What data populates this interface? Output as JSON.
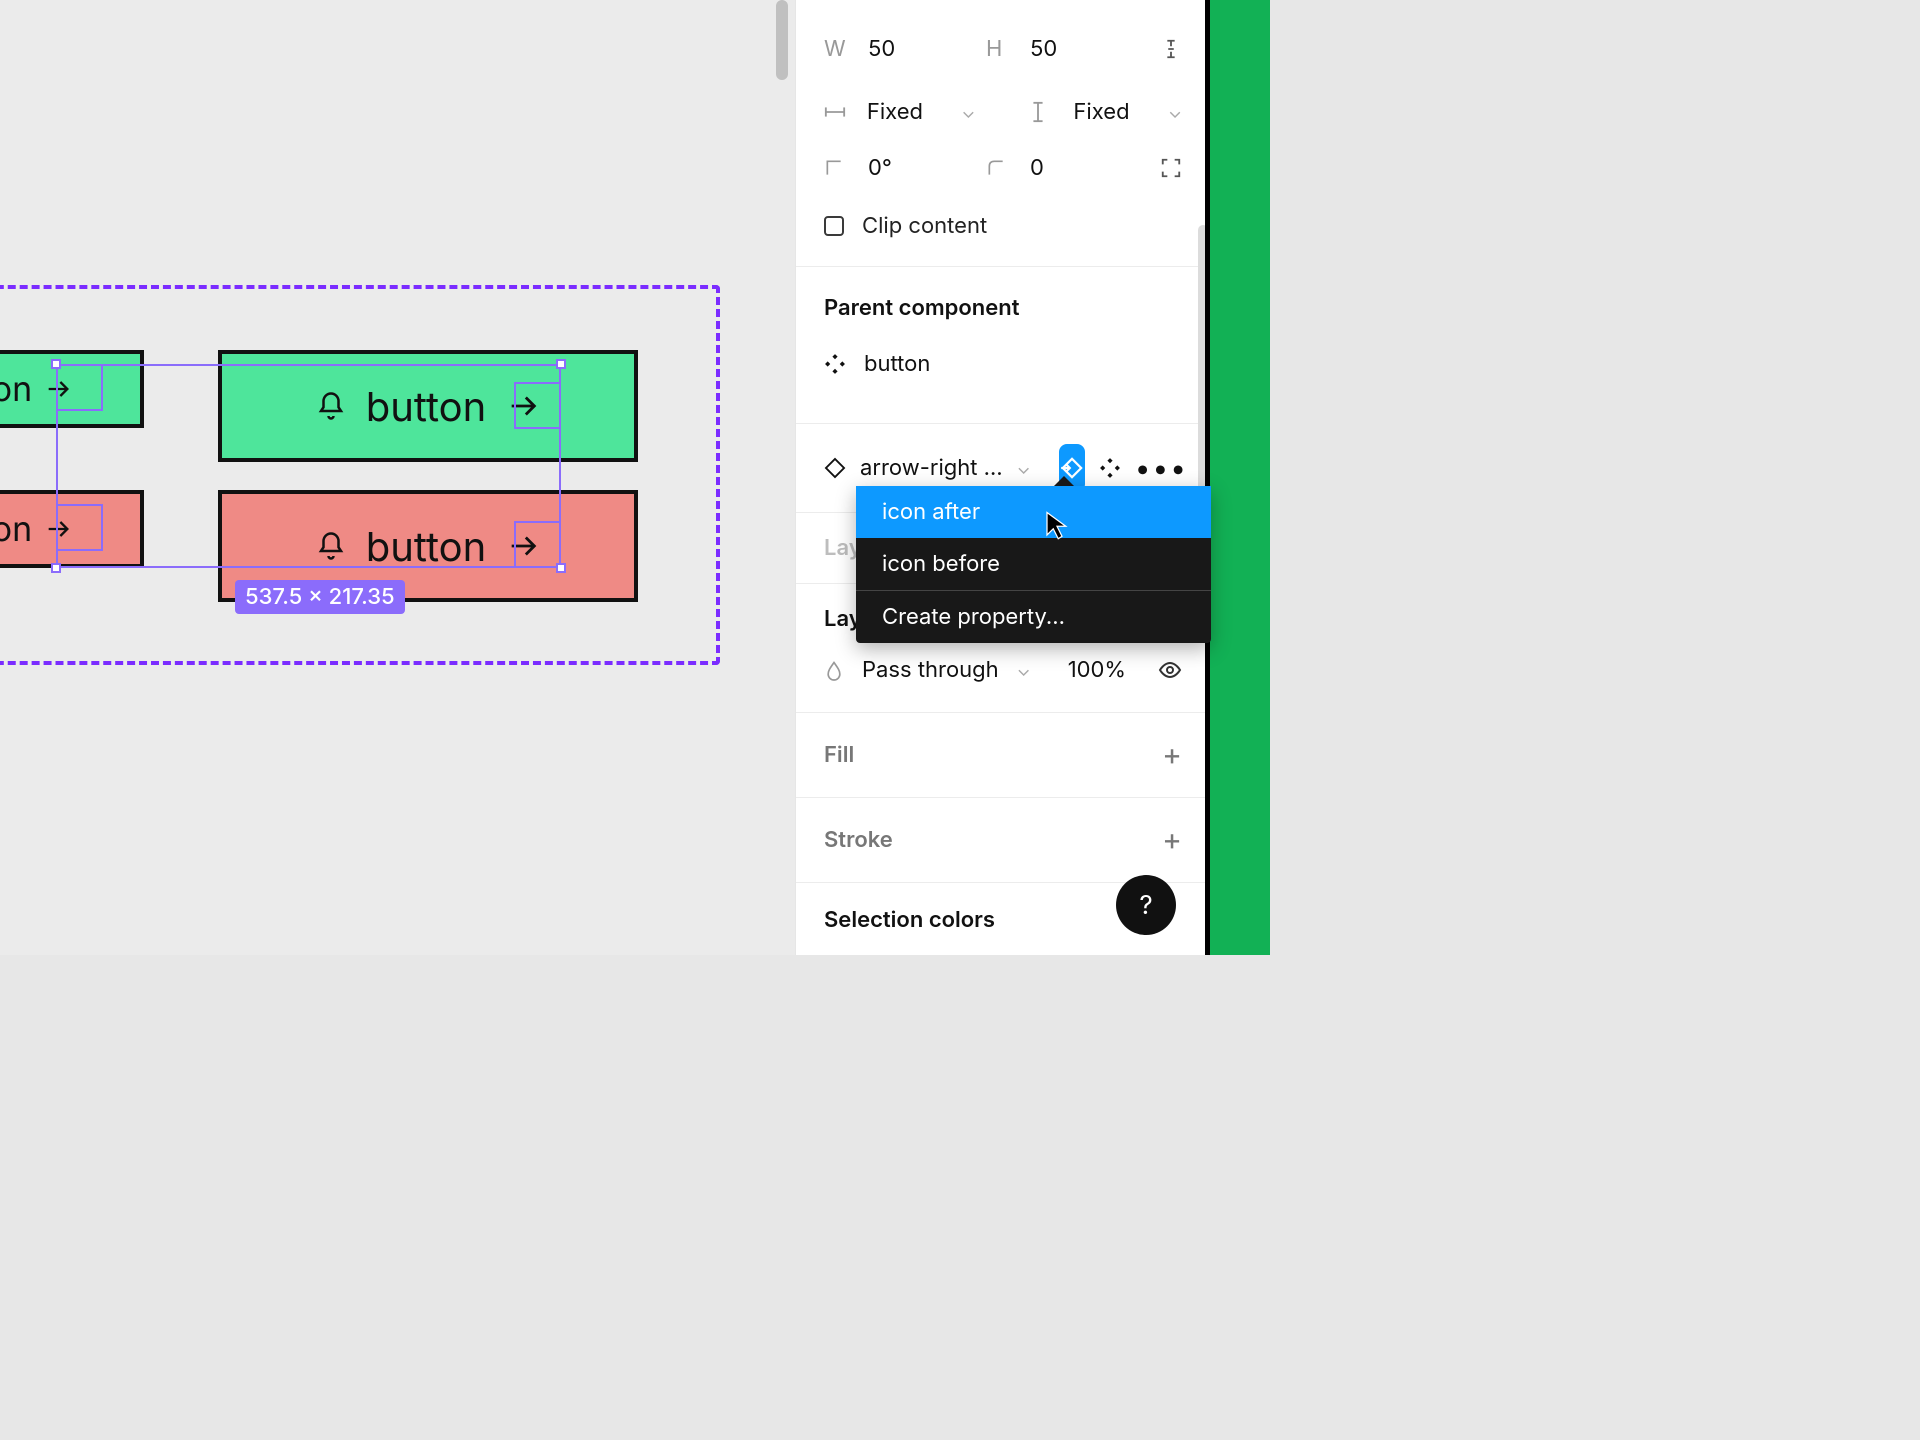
{
  "canvas": {
    "button_label": "button",
    "button_label_partial": "on",
    "dimension_badge": "537.5 × 217.35"
  },
  "panel": {
    "width_label": "W",
    "width_value": "50",
    "height_label": "H",
    "height_value": "50",
    "h_constraint": "Fixed",
    "v_constraint": "Fixed",
    "rotation": "0°",
    "corner_radius": "0",
    "clip_content_label": "Clip content",
    "parent_component_title": "Parent component",
    "parent_component_name": "button",
    "instance_name": "arrow-right …",
    "layout_section_partial": "Lay",
    "layer_section_title": "Layer",
    "blend_mode": "Pass through",
    "opacity": "100%",
    "fill_title": "Fill",
    "stroke_title": "Stroke",
    "selection_colors_title": "Selection colors"
  },
  "menu": {
    "items": [
      "icon after",
      "icon before"
    ],
    "create": "Create property..."
  },
  "help_label": "?"
}
